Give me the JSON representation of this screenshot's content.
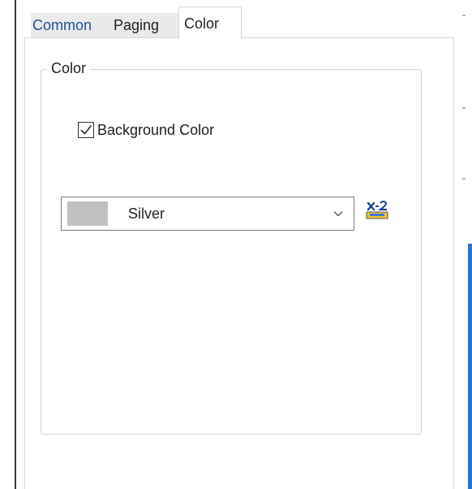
{
  "tabs": [
    {
      "label": "Common",
      "selected": false
    },
    {
      "label": "Paging",
      "selected": false
    },
    {
      "label": "Color",
      "selected": true
    }
  ],
  "color_group": {
    "title": "Color",
    "background_checkbox": {
      "label": "Background Color",
      "checked": true
    },
    "color_select": {
      "value": "Silver",
      "swatch_color": "#c0c0c0"
    },
    "expression_button": {
      "icon": "x2-expression-icon"
    }
  }
}
